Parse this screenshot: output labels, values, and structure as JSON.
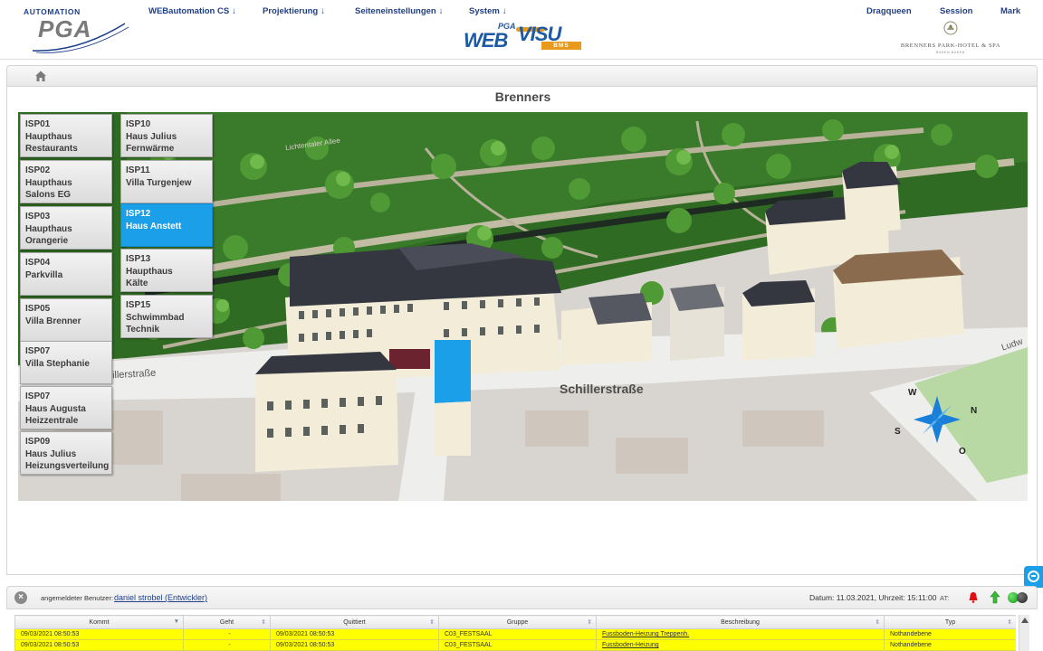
{
  "header": {
    "logo_top": "AUTOMATION",
    "logo_main": "PGA",
    "nav": [
      {
        "label": "WEBautomation CS",
        "arrow": "↓"
      },
      {
        "label": "Projektierung",
        "arrow": "↓"
      },
      {
        "label": "Seiteneinstellungen",
        "arrow": "↓"
      },
      {
        "label": "System",
        "arrow": "↓"
      }
    ],
    "nav_right": [
      "Dragqueen",
      "Session",
      "Mark"
    ],
    "center_logo": {
      "pga": "PGA",
      "web": "WEB",
      "visu": "VISU",
      "bms": "BMS"
    },
    "hotel_logo": {
      "name": "BRENNERS PARK-HOTEL & SPA",
      "sub": "BADEN-BADEN"
    }
  },
  "page": {
    "title": "Brenners"
  },
  "map": {
    "street_label_main": "Schillerstraße",
    "street_label_left": "illerstraße",
    "street_label_top": "Lichtentaler Allee",
    "street_label_right": "Ludw",
    "compass": [
      "W",
      "N",
      "S",
      "O"
    ]
  },
  "isp_buttons": [
    {
      "id": "isp01",
      "label": "ISP01\nHaupthaus\nRestaurants",
      "active": false
    },
    {
      "id": "isp02",
      "label": "ISP02\nHaupthaus\nSalons EG",
      "active": false
    },
    {
      "id": "isp03",
      "label": "ISP03\nHaupthaus\nOrangerie",
      "active": false
    },
    {
      "id": "isp04",
      "label": "ISP04\nParkvilla",
      "active": false
    },
    {
      "id": "isp05",
      "label": "ISP05\nVilla Brenner",
      "active": false
    },
    {
      "id": "isp07a",
      "label": "ISP07\nVilla Stephanie",
      "active": false
    },
    {
      "id": "isp07b",
      "label": "ISP07\nHaus Augusta\nHeizzentrale",
      "active": false
    },
    {
      "id": "isp09",
      "label": "ISP09\nHaus Julius\nHeizungsverteilung",
      "active": false
    },
    {
      "id": "isp10",
      "label": "ISP10\nHaus Julius\nFernwärme",
      "active": false
    },
    {
      "id": "isp11",
      "label": "ISP11\nVilla Turgenjew",
      "active": false
    },
    {
      "id": "isp12",
      "label": "ISP12\nHaus Anstett",
      "active": true
    },
    {
      "id": "isp13",
      "label": "ISP13\nHaupthaus\nKälte",
      "active": false
    },
    {
      "id": "isp15",
      "label": "ISP15\nSchwimmbad\nTechnik",
      "active": false
    }
  ],
  "status": {
    "user_label": "angemeldeter Benutzer:",
    "user_name": "daniel strobel (Entwickler)",
    "datetime": "Datum: 11.03.2021, Uhrzeit: 15:11:00",
    "at": "AT:"
  },
  "alarm_table": {
    "columns": [
      "Kommt",
      "Geht",
      "Quittiert",
      "Gruppe",
      "Beschreibung",
      "Typ"
    ],
    "rows": [
      [
        "09/03/2021 08:50:53",
        "-",
        "09/03/2021 08:50:53",
        "C03_FESTSAAL",
        "Fussboden-Heizung Treppenh.",
        "Nothandebene"
      ],
      [
        "09/03/2021 08:50:53",
        "-",
        "09/03/2021 08:50:53",
        "C03_FESTSAAL",
        "Fussboden-Heizung",
        "Nothandebene"
      ]
    ]
  },
  "colors": {
    "accent": "#1a9fe8",
    "nav_text": "#1f3f86",
    "alarm_row": "#ffff00",
    "lawn": "#2e6b22",
    "roof": "#33363f"
  }
}
